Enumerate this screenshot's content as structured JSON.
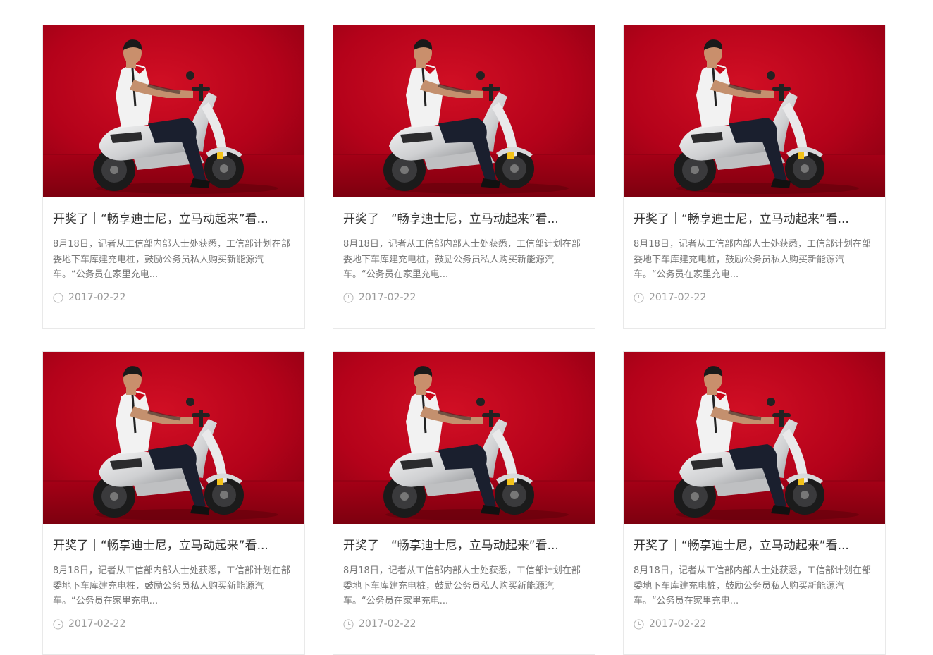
{
  "articles": [
    {
      "image": "red-scooter-photo",
      "title": "开奖了｜“畅享迪士尼，立马动起来”看...",
      "summary": "8月18日，记者从工信部内部人士处获悉，工信部计划在部委地下车库建充电桩，鼓励公务员私人购买新能源汽车。“公务员在家里充电...",
      "date": "2017-02-22"
    },
    {
      "image": "red-scooter-photo",
      "title": "开奖了｜“畅享迪士尼，立马动起来”看...",
      "summary": "8月18日，记者从工信部内部人士处获悉，工信部计划在部委地下车库建充电桩，鼓励公务员私人购买新能源汽车。“公务员在家里充电...",
      "date": "2017-02-22"
    },
    {
      "image": "red-scooter-photo",
      "title": "开奖了｜“畅享迪士尼，立马动起来”看...",
      "summary": "8月18日，记者从工信部内部人士处获悉，工信部计划在部委地下车库建充电桩，鼓励公务员私人购买新能源汽车。“公务员在家里充电...",
      "date": "2017-02-22"
    },
    {
      "image": "red-scooter-photo",
      "title": "开奖了｜“畅享迪士尼，立马动起来”看...",
      "summary": "8月18日，记者从工信部内部人士处获悉，工信部计划在部委地下车库建充电桩，鼓励公务员私人购买新能源汽车。“公务员在家里充电...",
      "date": "2017-02-22"
    },
    {
      "image": "red-scooter-photo",
      "title": "开奖了｜“畅享迪士尼，立马动起来”看...",
      "summary": "8月18日，记者从工信部内部人士处获悉，工信部计划在部委地下车库建充电桩，鼓励公务员私人购买新能源汽车。“公务员在家里充电...",
      "date": "2017-02-22"
    },
    {
      "image": "red-scooter-photo",
      "title": "开奖了｜“畅享迪士尼，立马动起来”看...",
      "summary": "8月18日，记者从工信部内部人士处获悉，工信部计划在部委地下车库建充电桩，鼓励公务员私人购买新能源汽车。“公务员在家里充电...",
      "date": "2017-02-22"
    }
  ],
  "icons": {
    "date": "clock-icon"
  },
  "colors": {
    "photo_background": "#b3001a",
    "title_text": "#333333",
    "summary_text": "#777777",
    "meta_text": "#999999",
    "card_border": "#e9e9e9"
  }
}
